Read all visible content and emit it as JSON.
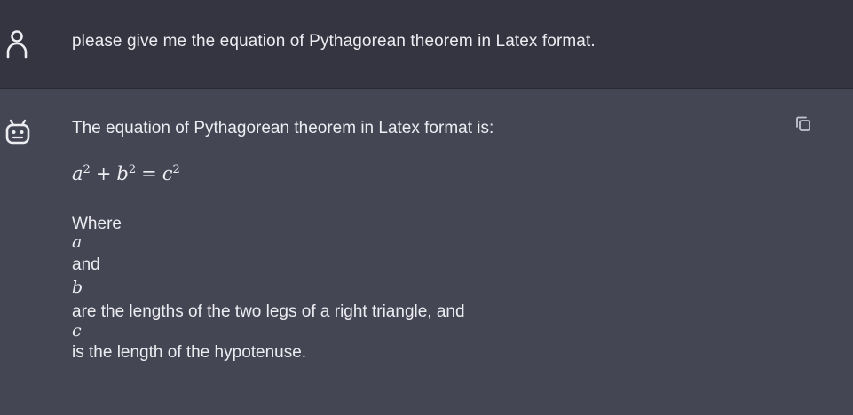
{
  "conversation": {
    "user_message": {
      "avatar_icon": "user-icon",
      "text": "please give me the equation of Pythagorean theorem in Latex format."
    },
    "assistant_message": {
      "avatar_icon": "robot-icon",
      "intro": "The equation of Pythagorean theorem in Latex format is:",
      "equation": {
        "a": "a",
        "b": "b",
        "c": "c",
        "exp": "2",
        "plus": "+",
        "equals": "="
      },
      "where_label": "Where",
      "var_a": "a",
      "and_label": "and",
      "var_b": "b",
      "legs_text": "are the lengths of the two legs of a right triangle, and",
      "var_c": "c",
      "hypotenuse_text": "is the length of the hypotenuse.",
      "copy_icon": "copy-icon"
    }
  },
  "colors": {
    "user_bg": "#343541",
    "assistant_bg": "#444654",
    "text": "#ececf1"
  }
}
